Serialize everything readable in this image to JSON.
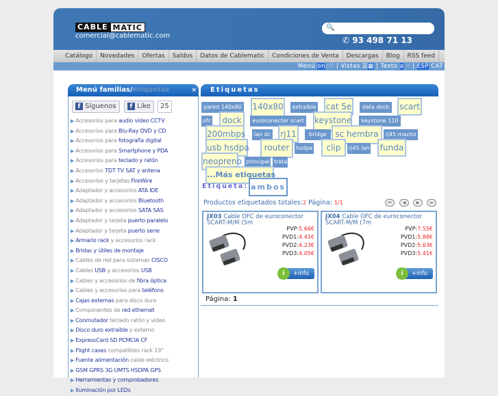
{
  "header": {
    "logo_a": "CABLE",
    "logo_b": "MATIC",
    "email": "comercial@cablematic.com",
    "search_placeholder": "",
    "phone": "93 498 71 13"
  },
  "nav": [
    "Catálogo",
    "Novedades",
    "Ofertas",
    "Saldos",
    "Datos de Cablematic",
    "Condiciones de Venta",
    "Descargas",
    "Blog",
    "RSS feed"
  ],
  "subbar": {
    "menu": "Menú",
    "on": "on",
    "off": "off",
    "vistas": "| Vistas",
    "texto": "| Texto",
    "a_small": "a",
    "a_big": "A",
    "sep": "|",
    "esp": "ESP",
    "cat": "CAT"
  },
  "sidebar": {
    "title": "Menú familias/",
    "title_ghost": "etiquetas",
    "close": "×",
    "follow": "Síguenos",
    "like": "Like",
    "like_count": "25",
    "items": [
      [
        [
          "Accesorios para ",
          0
        ],
        [
          "audio video CCTV",
          1
        ]
      ],
      [
        [
          "Accesorios para ",
          0
        ],
        [
          "Blu-Ray DVD y CD",
          1
        ]
      ],
      [
        [
          "Accesorios para ",
          0
        ],
        [
          "fotografía digital",
          1
        ]
      ],
      [
        [
          "Accesorios para ",
          0
        ],
        [
          "Smartphone y PDA",
          1
        ]
      ],
      [
        [
          "Accesorios para ",
          0
        ],
        [
          "teclado y ratón",
          1
        ]
      ],
      [
        [
          "Accesorios ",
          0
        ],
        [
          "TDT TV SAT y antena",
          1
        ]
      ],
      [
        [
          "Accesorios y tarjetas ",
          0
        ],
        [
          "FireWire",
          1
        ]
      ],
      [
        [
          "Adaptador y accesorios ",
          0
        ],
        [
          "ATA IDE",
          1
        ]
      ],
      [
        [
          "Adaptador y accesorios ",
          0
        ],
        [
          "Bluetooth",
          1
        ]
      ],
      [
        [
          "Adaptador y accesorios ",
          0
        ],
        [
          "SATA SAS",
          1
        ]
      ],
      [
        [
          "Adaptador y tarjeta ",
          0
        ],
        [
          "puerto paralelo",
          1
        ]
      ],
      [
        [
          "Adaptador y tarjeta ",
          0
        ],
        [
          "puerto serie",
          1
        ]
      ],
      [
        [
          "Armario rack",
          1
        ],
        [
          " y accesorios rack",
          0
        ]
      ],
      [
        [
          "Bridas y útiles de montaje",
          1
        ]
      ],
      [
        [
          "Cables de red para sistemas ",
          0
        ],
        [
          "CISCO",
          1
        ]
      ],
      [
        [
          "Cables ",
          0
        ],
        [
          "USB",
          1
        ],
        [
          " y accesorios ",
          0
        ],
        [
          "USB",
          1
        ]
      ],
      [
        [
          "Cables y accesorios de ",
          0
        ],
        [
          "fibra óptica",
          1
        ]
      ],
      [
        [
          "Cables y accesorios para ",
          0
        ],
        [
          "teléfono",
          1
        ]
      ],
      [
        [
          "Cajas externas",
          1
        ],
        [
          " para disco duro",
          0
        ]
      ],
      [
        [
          "Componentes de ",
          0
        ],
        [
          "red ethernet",
          1
        ]
      ],
      [
        [
          "Conmutador",
          1
        ],
        [
          " teclado ratón y video",
          0
        ]
      ],
      [
        [
          "Disco duro extraible",
          1
        ],
        [
          " y externo",
          0
        ]
      ],
      [
        [
          "ExpressCard SD PCMCIA CF",
          1
        ]
      ],
      [
        [
          "Flight cases",
          1
        ],
        [
          " compatibles rack 19\"",
          0
        ]
      ],
      [
        [
          "Fuente alimentación",
          1
        ],
        [
          " cable eléctrico",
          0
        ]
      ],
      [
        [
          "GSM GPRS 3G UMTS HSDPA GPS",
          1
        ]
      ],
      [
        [
          "Herramientas y comprobadores",
          1
        ]
      ],
      [
        [
          "Iluminación por LEDs",
          1
        ]
      ]
    ]
  },
  "tags": {
    "title": "Etiquetas",
    "items": [
      "pared 140x80",
      "140x80",
      "extraible",
      "cat 5e",
      "data dock",
      "scart",
      "ofc",
      "dock",
      "euroconector scart",
      "keystone",
      "keystone 110",
      "200mbps",
      "lan dc",
      "rj11",
      "bridge",
      "sc hembra",
      "rj45 macho",
      "usb hsdpa",
      "router",
      "hsdpa",
      "clip",
      "rj45 lan",
      "funda",
      "neopreno",
      "principal",
      "trata"
    ],
    "more": "...Más etiquetas",
    "label": "Etiqueta:",
    "mode": "ambos"
  },
  "products": {
    "total_label": "Productos etiquetados totales:",
    "total": "2",
    "page_label": " Página:",
    "page": "1/1",
    "footer_label": "Página:",
    "footer_page": "1",
    "items": [
      {
        "code": "JX03",
        "title": " Cable OFC de euroconector SCART-M/M (5m",
        "pvp": "5.66€",
        "pvd1": "4.41€",
        "pvd2": "4.23€",
        "pvd3": "4.05€",
        "info": "+info"
      },
      {
        "code": "JX04",
        "title": " Cable OFC de euroconector SCART-M/M (7m",
        "pvp": "7.55€",
        "pvd1": "5.88€",
        "pvd2": "5.63€",
        "pvd3": "5.41€",
        "info": "+info"
      }
    ],
    "labels": {
      "pvp": "PVP:",
      "pvd1": "PVD1:",
      "pvd2": "PVD2:",
      "pvd3": "PVD3:"
    }
  },
  "colors": {
    "brand_blue": "#3a72b0",
    "price_red": "#ee2222",
    "tag_blue": "#6a96cc",
    "tag_yellow": "#ffffcc"
  }
}
